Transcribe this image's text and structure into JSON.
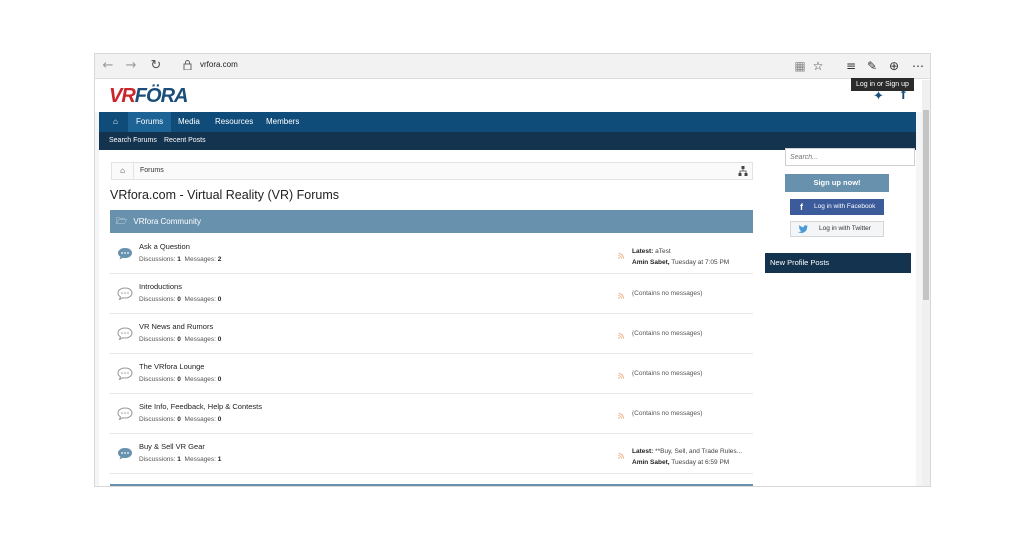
{
  "browser": {
    "url": "vrfora.com",
    "tooltip": "Log in or Sign up"
  },
  "header": {
    "logo_left": "VR",
    "logo_right": "FÖRA"
  },
  "nav": {
    "tabs": [
      {
        "label": "Forums"
      },
      {
        "label": "Media"
      },
      {
        "label": "Resources"
      },
      {
        "label": "Members"
      }
    ],
    "sub_links": [
      {
        "label": "Search Forums"
      },
      {
        "label": "Recent Posts"
      }
    ]
  },
  "breadcrumb": {
    "item": "Forums"
  },
  "page_title": "VRfora.com - Virtual Reality (VR) Forums",
  "category": {
    "title": "VRfora Community"
  },
  "labels": {
    "discussions": "Discussions:",
    "messages": "Messages:"
  },
  "nodes": [
    {
      "title": "Ask a Question",
      "discussions": "1",
      "messages": "2",
      "latest_label": "Latest:",
      "latest_title": "aTest",
      "latest_user": "Amin Sabet,",
      "latest_time": "Tuesday at 7:05 PM",
      "empty": ""
    },
    {
      "title": "Introductions",
      "discussions": "0",
      "messages": "0",
      "empty": "(Contains no messages)"
    },
    {
      "title": "VR News and Rumors",
      "discussions": "0",
      "messages": "0",
      "empty": "(Contains no messages)"
    },
    {
      "title": "The VRfora Lounge",
      "discussions": "0",
      "messages": "0",
      "empty": "(Contains no messages)"
    },
    {
      "title": "Site Info, Feedback, Help & Contests",
      "discussions": "0",
      "messages": "0",
      "empty": "(Contains no messages)"
    },
    {
      "title": "Buy & Sell VR Gear",
      "discussions": "1",
      "messages": "1",
      "latest_label": "Latest:",
      "latest_title": "**Buy, Sell, and Trade Rules...",
      "latest_user": "Amin Sabet,",
      "latest_time": "Tuesday at 6:59 PM",
      "empty": ""
    }
  ],
  "sidebar": {
    "search_placeholder": "Search...",
    "signup": "Sign up now!",
    "facebook": "Log in with Facebook",
    "twitter": "Log in with Twitter",
    "profile_posts": "New Profile Posts"
  },
  "colors": {
    "nav_blue": "#0f4c7a",
    "subnav_navy": "#13334f",
    "category_blue": "#6791ad",
    "logo_red": "#c9252b"
  }
}
